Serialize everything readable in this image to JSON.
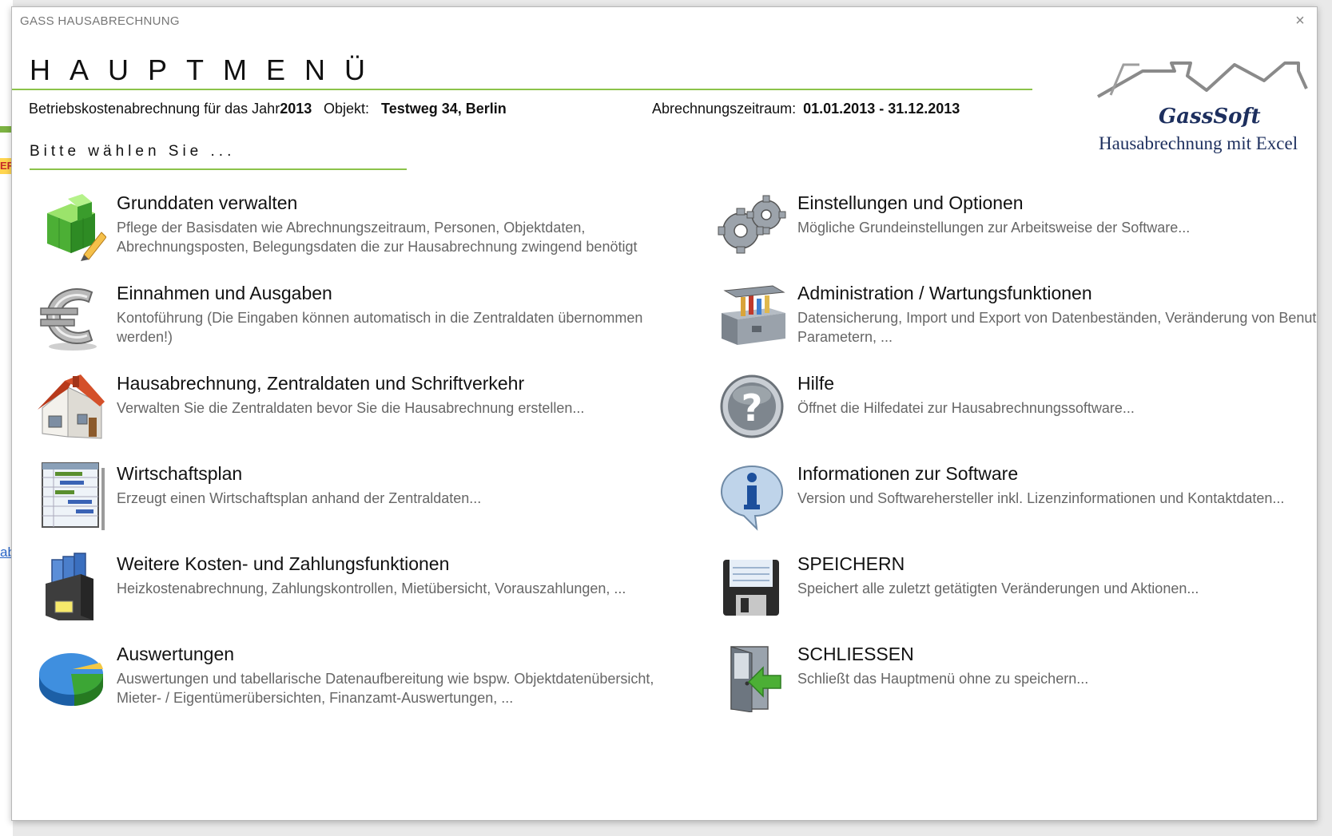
{
  "window": {
    "title": "GASS HAUSABRECHNUNG",
    "close_symbol": "×"
  },
  "background": {
    "tag": "ER",
    "link": "ab"
  },
  "header": {
    "heading": "HAUPTMENÜ"
  },
  "info": {
    "year_label": "Betriebskostenabrechnung für das Jahr",
    "year_value": "2013",
    "object_label": "Objekt:",
    "object_value": "Testweg 34, Berlin",
    "period_label": "Abrechnungszeitraum:",
    "period_value": "01.01.2013 - 31.12.2013"
  },
  "prompt": "Bitte wählen Sie ...",
  "logo": {
    "brand": "GassSoft",
    "subtitle": "Hausabrechnung mit Excel"
  },
  "menu": {
    "left": [
      {
        "title": "Grunddaten verwalten",
        "desc": "Pflege der Basisdaten wie Abrechnungszeitraum, Personen, Objektdaten, Abrechnungsposten, Belegungsdaten die zur Hausabrechnung zwingend benötigt",
        "icon": "cube-edit-icon"
      },
      {
        "title": "Einnahmen und Ausgaben",
        "desc": "Kontoführung (Die Eingaben können automatisch in die Zentraldaten übernommen werden!)",
        "icon": "euro-icon"
      },
      {
        "title": "Hausabrechnung, Zentraldaten und Schriftverkehr",
        "desc": "Verwalten Sie die Zentraldaten bevor Sie die Hausabrechnung erstellen...",
        "icon": "house-icon"
      },
      {
        "title": "Wirtschaftsplan",
        "desc": "Erzeugt einen Wirtschaftsplan anhand der Zentraldaten...",
        "icon": "gantt-chart-icon"
      },
      {
        "title": "Weitere Kosten- und Zahlungsfunktionen",
        "desc": "Heizkostenabrechnung, Zahlungskontrollen, Mietübersicht, Vorauszahlungen, ...",
        "icon": "folders-icon"
      },
      {
        "title": "Auswertungen",
        "desc": "Auswertungen und tabellarische Datenaufbereitung wie bspw. Objektdatenübersicht, Mieter- / Eigentümerübersichten, Finanzamt-Auswertungen, ...",
        "icon": "pie-chart-icon"
      }
    ],
    "right": [
      {
        "title": "Einstellungen und Optionen",
        "desc": "Mögliche Grundeinstellungen zur Arbeitsweise der Software...",
        "icon": "gears-icon"
      },
      {
        "title": "Administration / Wartungsfunktionen",
        "desc": "Datensicherung, Import und Export von Datenbeständen, Veränderung von Benutzer-Parametern, ...",
        "icon": "toolbox-icon"
      },
      {
        "title": "Hilfe",
        "desc": "Öffnet die Hilfedatei zur Hausabrechnungssoftware...",
        "icon": "help-icon"
      },
      {
        "title": "Informationen zur Software",
        "desc": "Version und Softwarehersteller inkl. Lizenzinformationen und Kontaktdaten...",
        "icon": "info-icon"
      },
      {
        "title": "SPEICHERN",
        "desc": "Speichert alle zuletzt getätigten Veränderungen und Aktionen...",
        "icon": "floppy-disk-icon"
      },
      {
        "title": "SCHLIESSEN",
        "desc": "Schließt das Hauptmenü ohne zu speichern...",
        "icon": "exit-door-icon"
      }
    ]
  }
}
